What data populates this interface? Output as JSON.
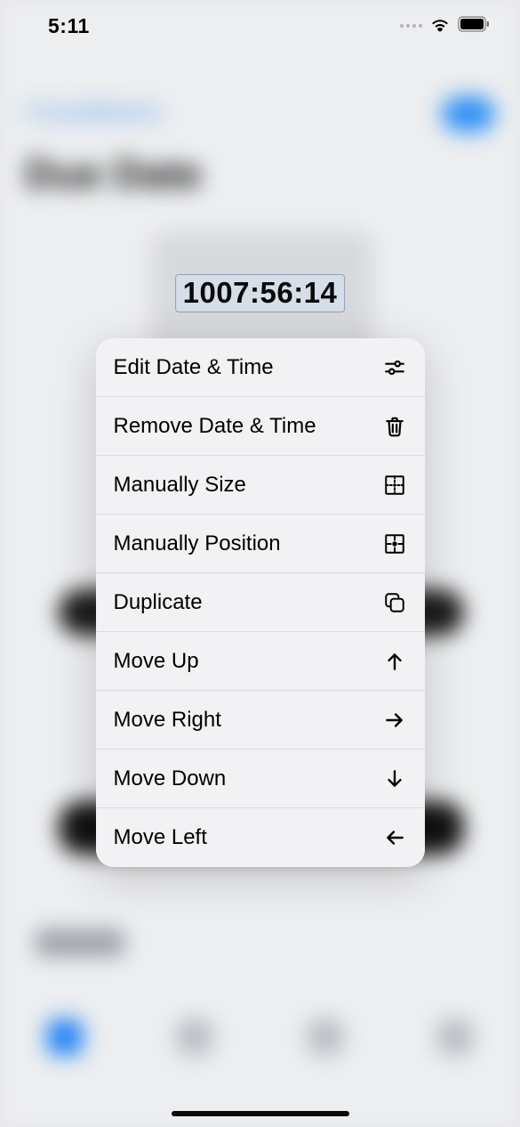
{
  "status": {
    "time": "5:11"
  },
  "timer": {
    "value": "1007:56:14"
  },
  "menu": {
    "edit": {
      "label": "Edit Date & Time"
    },
    "remove": {
      "label": "Remove Date & Time"
    },
    "size": {
      "label": "Manually Size"
    },
    "position": {
      "label": "Manually Position"
    },
    "duplicate": {
      "label": "Duplicate"
    },
    "move_up": {
      "label": "Move Up"
    },
    "move_right": {
      "label": "Move Right"
    },
    "move_down": {
      "label": "Move Down"
    },
    "move_left": {
      "label": "Move Left"
    }
  },
  "background": {
    "nav_back": "‹ Countdowns",
    "page_title": "Due Date"
  }
}
